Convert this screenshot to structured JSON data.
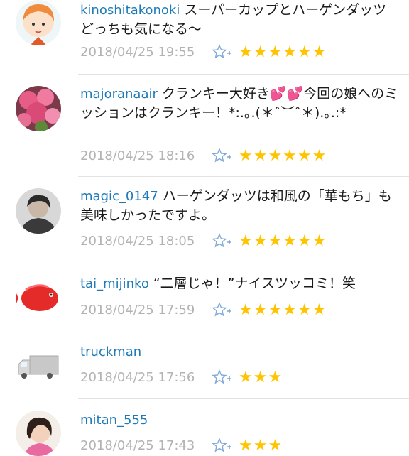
{
  "colors": {
    "username": "#1e7bb8",
    "timestamp": "#b3b3b3",
    "star": "#ffc400",
    "fav_icon": "#7fa8d6"
  },
  "comments": [
    {
      "user": "kinoshitakonoki",
      "text": "スーパーカップとハーゲンダッツどっちも気になる〜",
      "time": "2018/04/25 19:55",
      "stars": "★★★★★★"
    },
    {
      "user": "majoranaair",
      "text": "クランキー大好き💕💕今回の娘へのミッションはクランキー！*:.｡.(＊ˆ︶ˆ＊).｡.:*",
      "time": "2018/04/25 18:16",
      "stars": "★★★★★★"
    },
    {
      "user": "magic_0147",
      "text": "ハーゲンダッツは和風の「華もち」も美味しかったですよ。",
      "time": "2018/04/25 18:05",
      "stars": "★★★★★★"
    },
    {
      "user": "tai_mijinko",
      "text": "“二層じゃ！”ナイスツッコミ！笑",
      "time": "2018/04/25 17:59",
      "stars": "★★★★★★"
    },
    {
      "user": "truckman",
      "text": "",
      "time": "2018/04/25 17:56",
      "stars": "★★★"
    },
    {
      "user": "mitan_555",
      "text": "",
      "time": "2018/04/25 17:43",
      "stars": "★★★"
    }
  ]
}
